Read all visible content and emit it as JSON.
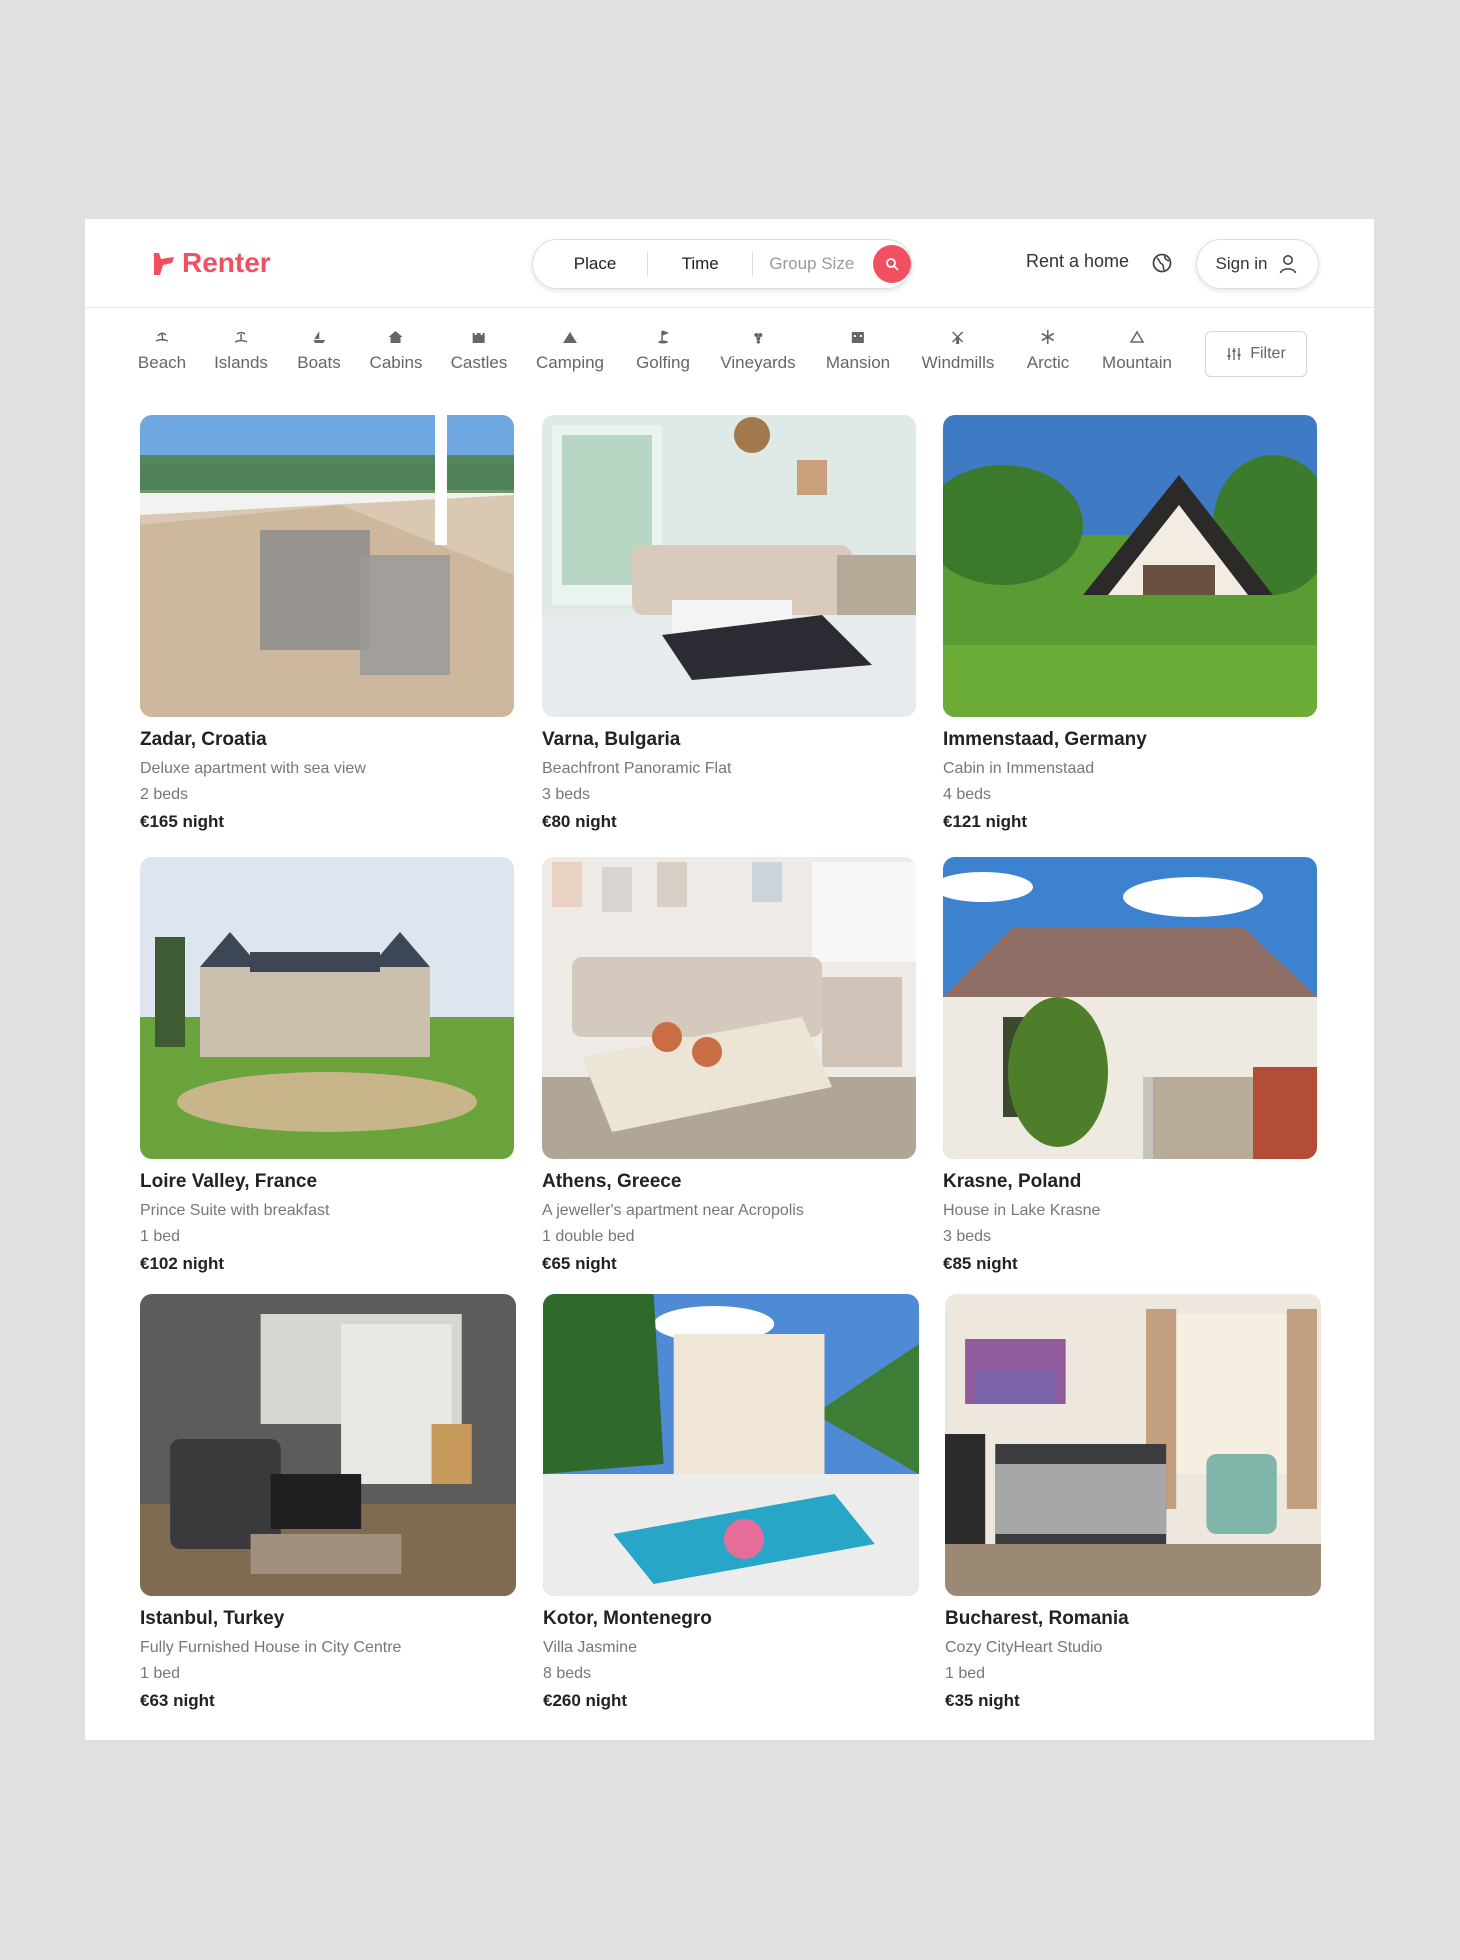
{
  "brand": {
    "name": "Renter",
    "color": "#f0505f"
  },
  "search": {
    "place_label": "Place",
    "time_label": "Time",
    "group_placeholder": "Group Size",
    "button_icon": "search-icon"
  },
  "nav": {
    "rent_label": "Rent a home",
    "globe_icon": "globe-icon",
    "signin_label": "Sign in",
    "user_icon": "user-icon"
  },
  "categories": [
    {
      "label": "Beach",
      "icon": "beach-icon"
    },
    {
      "label": "Islands",
      "icon": "island-icon"
    },
    {
      "label": "Boats",
      "icon": "boat-icon"
    },
    {
      "label": "Cabins",
      "icon": "cabin-icon"
    },
    {
      "label": "Castles",
      "icon": "castle-icon"
    },
    {
      "label": "Camping",
      "icon": "tent-icon"
    },
    {
      "label": "Golfing",
      "icon": "golf-icon"
    },
    {
      "label": "Vineyards",
      "icon": "grapes-icon"
    },
    {
      "label": "Mansion",
      "icon": "mansion-icon"
    },
    {
      "label": "Windmills",
      "icon": "windmill-icon"
    },
    {
      "label": "Arctic",
      "icon": "snowflake-icon"
    },
    {
      "label": "Mountain",
      "icon": "mountain-icon"
    }
  ],
  "filter_label": "Filter",
  "listings": [
    {
      "location": "Zadar, Croatia",
      "description": "Deluxe apartment with sea view",
      "beds": "2 beds",
      "price": "€165 night"
    },
    {
      "location": "Varna, Bulgaria",
      "description": "Beachfront Panoramic Flat",
      "beds": "3 beds",
      "price": "€80 night"
    },
    {
      "location": "Immenstaad, Germany",
      "description": "Cabin in Immenstaad",
      "beds": "4 beds",
      "price": "€121 night"
    },
    {
      "location": "Loire Valley, France",
      "description": "Prince Suite with breakfast",
      "beds": "1 bed",
      "price": "€102 night"
    },
    {
      "location": "Athens, Greece",
      "description": "A jeweller's apartment near Acropolis",
      "beds": "1 double bed",
      "price": "€65 night"
    },
    {
      "location": "Krasne, Poland",
      "description": "House in Lake Krasne",
      "beds": "3 beds",
      "price": "€85 night"
    },
    {
      "location": "Istanbul, Turkey",
      "description": "Fully Furnished House in City Centre",
      "beds": "1 bed",
      "price": "€63 night"
    },
    {
      "location": "Kotor, Montenegro",
      "description": "Villa Jasmine",
      "beds": "8 beds",
      "price": "€260 night"
    },
    {
      "location": "Bucharest, Romania",
      "description": "Cozy CityHeart Studio",
      "beds": "1 bed",
      "price": "€35 night"
    }
  ]
}
